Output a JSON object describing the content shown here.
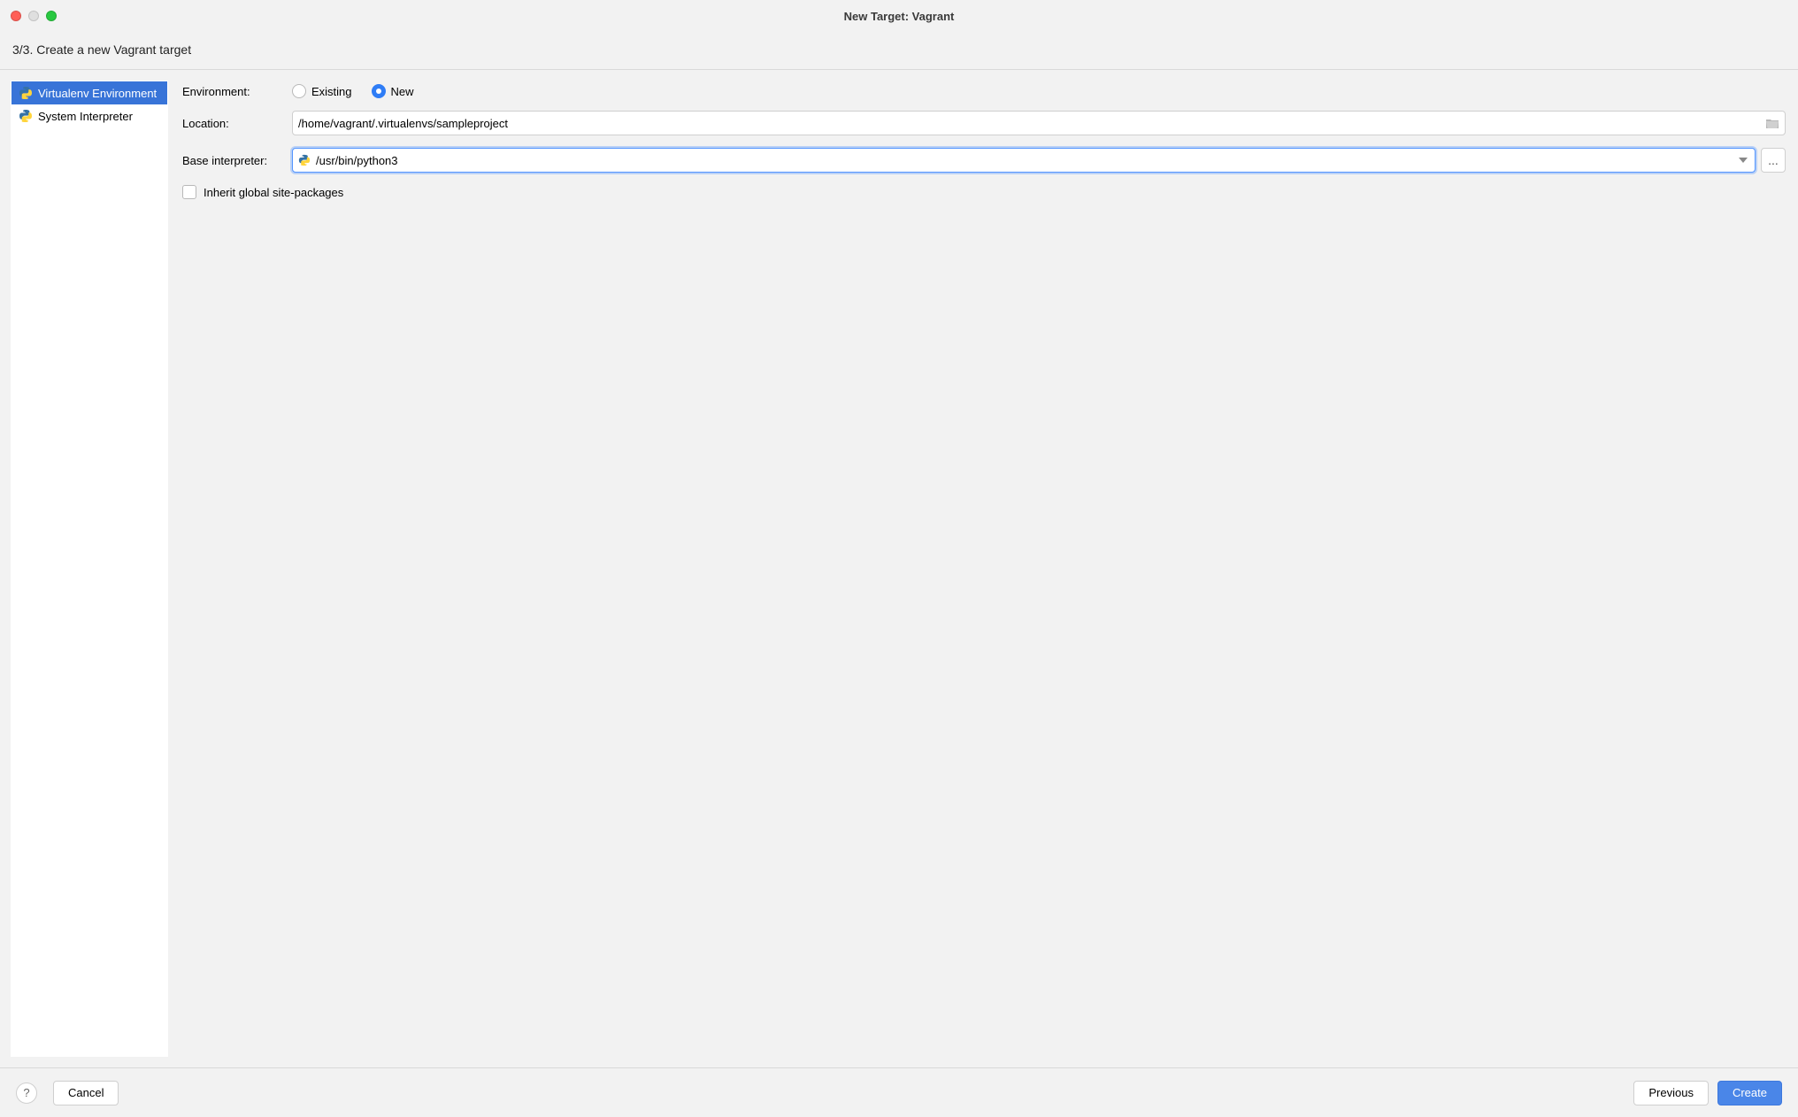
{
  "window": {
    "title": "New Target: Vagrant"
  },
  "step": {
    "label": "3/3. Create a new Vagrant target"
  },
  "sidebar": {
    "items": [
      {
        "label": "Virtualenv Environment",
        "selected": true
      },
      {
        "label": "System Interpreter",
        "selected": false
      }
    ]
  },
  "form": {
    "environment_label": "Environment:",
    "environment_options": {
      "existing_label": "Existing",
      "new_label": "New",
      "selected": "new"
    },
    "location_label": "Location:",
    "location_value": "/home/vagrant/.virtualenvs/sampleproject",
    "base_interpreter_label": "Base interpreter:",
    "base_interpreter_value": "/usr/bin/python3",
    "browse_label": "...",
    "inherit_label": "Inherit global site-packages",
    "inherit_checked": false
  },
  "footer": {
    "help_label": "?",
    "cancel_label": "Cancel",
    "previous_label": "Previous",
    "create_label": "Create"
  },
  "colors": {
    "accent": "#3874d8",
    "primary_button": "#4a86e8"
  }
}
